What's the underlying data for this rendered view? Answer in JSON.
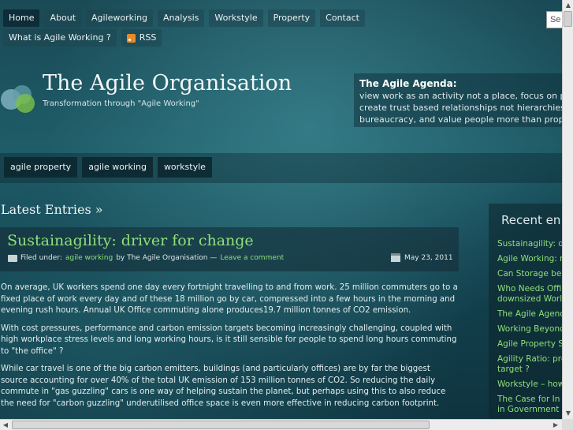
{
  "nav": {
    "items": [
      "Home",
      "About",
      "Agileworking",
      "Analysis",
      "Workstyle",
      "Property",
      "Contact"
    ],
    "sub_items": [
      "What is Agile Working ?",
      "RSS"
    ],
    "search_value": "Se"
  },
  "header": {
    "title": "The Agile Organisation",
    "tagline": "Transformation through \"Agile Working\"",
    "agenda_title": "The Agile Agenda:",
    "agenda_lines": [
      "view work as an activity not a place, focus on per",
      "create trust based relationships not hierarchies,",
      "bureaucracy, and value people more than propert"
    ]
  },
  "tags": [
    "agile property",
    "agile working",
    "workstyle"
  ],
  "main": {
    "heading": "Latest Entries »",
    "post": {
      "title": "Sustainagility: driver for change",
      "filed_under": "Filed under:",
      "category": "agile working",
      "by": "by The Agile Organisation —",
      "comment": "Leave a comment",
      "date": "May 23, 2011",
      "paragraphs": [
        "On average, UK workers spend one day every fortnight travelling to and from work.  25 million commuters go to a fixed place of work every day and of these 18 million go by car, compressed into a few hours in the morning and evening rush hours.  Annual UK Office commuting alone produces19.7 million tonnes of CO2 emission.",
        "With cost pressures, performance and carbon emission targets becoming increasingly challenging, coupled with high workplace stress levels and long working hours, is it still sensible for people to spend long hours commuting to \"the office\" ?",
        "While car travel is one of the big carbon emitters, buildings (and particularly offices) are by far the biggest source accounting for over 40% of the total UK emission of 153 million tonnes of CO2. So reducing the daily commute in \"gas guzzling\" cars is one way of helping sustain the planet, but perhaps using this to also reduce the need for \"carbon guzzling\" underutilised office space is even more effective in reducing carbon footprint."
      ]
    }
  },
  "sidebar": {
    "title": "Recent en",
    "items": [
      "Sustainagility: d",
      "Agile Working: m",
      "Can Storage be",
      "Who Needs Offi downsized World",
      "The Agile Agenc",
      "Working Beyond",
      "Agile Property S",
      "Agility Ratio: pro target ?",
      "Workstyle – how",
      "The Case for In in Government"
    ]
  },
  "colors": {
    "link": "#8fe07a",
    "accent_bg": "#1d5a66"
  }
}
